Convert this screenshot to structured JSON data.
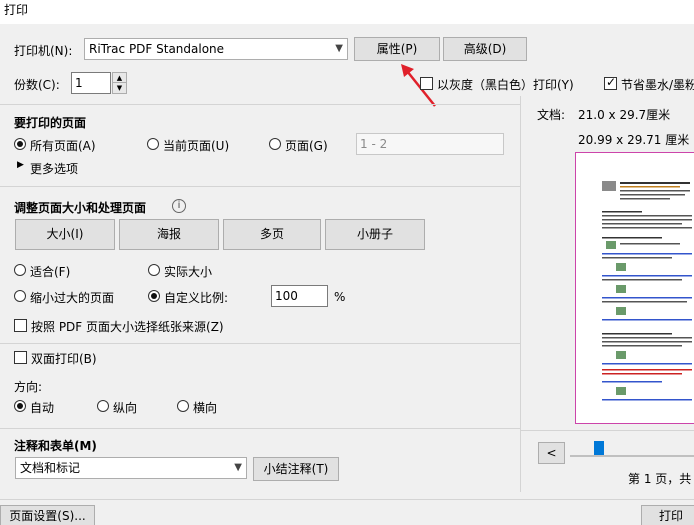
{
  "window": {
    "title": "打印"
  },
  "printer": {
    "label": "打印机(N):",
    "selected": "RiTrac PDF Standalone",
    "properties_button": "属性(P)",
    "advanced_button": "高级(D)"
  },
  "copies": {
    "label": "份数(C):",
    "value": "1",
    "grayscale_label": "以灰度（黑白色）打印(Y)",
    "grayscale_checked": false,
    "save_ink_label": "节省墨水/墨粉",
    "save_ink_checked": true
  },
  "pages_to_print": {
    "heading": "要打印的页面",
    "all_label": "所有页面(A)",
    "current_label": "当前页面(U)",
    "pages_label": "页面(G)",
    "pages_placeholder": "1 - 2",
    "selected": "all",
    "more_options": "更多选项"
  },
  "sizing": {
    "heading": "调整页面大小和处理页面",
    "tabs": [
      "大小(I)",
      "海报",
      "多页",
      "小册子"
    ],
    "fit_label": "适合(F)",
    "actual_size_label": "实际大小",
    "shrink_label": "缩小过大的页面",
    "custom_scale_label": "自定义比例:",
    "custom_scale_value": "100",
    "percent": "%",
    "selected": "custom",
    "paper_source_label": "按照 PDF 页面大小选择纸张来源(Z)",
    "paper_source_checked": false
  },
  "duplex": {
    "label": "双面打印(B)",
    "checked": false
  },
  "orientation": {
    "heading": "方向:",
    "auto_label": "自动",
    "portrait_label": "纵向",
    "landscape_label": "横向",
    "selected": "auto"
  },
  "comments": {
    "heading": "注释和表单(M)",
    "selected": "文档和标记",
    "summarize_button": "小结注释(T)"
  },
  "preview": {
    "doc_label": "文档:",
    "doc_size": "21.0 x 29.7厘米",
    "page_size": "20.99 x 29.71 厘米",
    "page_info": "第 1 页，共",
    "prev_button": "<"
  },
  "footer": {
    "page_setup_button": "页面设置(S)...",
    "print_button": "打印"
  },
  "colors": {
    "accent": "#0078d7",
    "annotation_arrow": "#e0202a",
    "preview_border": "#cc44aa"
  }
}
